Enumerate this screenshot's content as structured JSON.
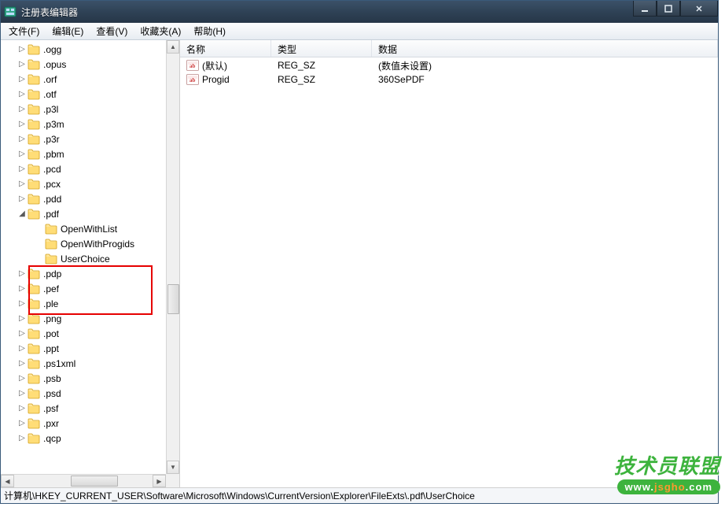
{
  "window": {
    "title": "注册表编辑器"
  },
  "menu": {
    "file": "文件(F)",
    "edit": "编辑(E)",
    "view": "查看(V)",
    "favorites": "收藏夹(A)",
    "help": "帮助(H)"
  },
  "tree": {
    "items": [
      {
        "label": ".ogg",
        "expanded": false
      },
      {
        "label": ".opus",
        "expanded": false
      },
      {
        "label": ".orf",
        "expanded": false
      },
      {
        "label": ".otf",
        "expanded": false
      },
      {
        "label": ".p3l",
        "expanded": false
      },
      {
        "label": ".p3m",
        "expanded": false
      },
      {
        "label": ".p3r",
        "expanded": false
      },
      {
        "label": ".pbm",
        "expanded": false
      },
      {
        "label": ".pcd",
        "expanded": false
      },
      {
        "label": ".pcx",
        "expanded": false
      },
      {
        "label": ".pdd",
        "expanded": false
      },
      {
        "label": ".pdf",
        "expanded": true
      },
      {
        "label": ".pdp",
        "expanded": false
      },
      {
        "label": ".pef",
        "expanded": false
      },
      {
        "label": ".ple",
        "expanded": false
      },
      {
        "label": ".png",
        "expanded": false
      },
      {
        "label": ".pot",
        "expanded": false
      },
      {
        "label": ".ppt",
        "expanded": false
      },
      {
        "label": ".ps1xml",
        "expanded": false
      },
      {
        "label": ".psb",
        "expanded": false
      },
      {
        "label": ".psd",
        "expanded": false
      },
      {
        "label": ".psf",
        "expanded": false
      },
      {
        "label": ".pxr",
        "expanded": false
      },
      {
        "label": ".qcp",
        "expanded": false
      }
    ],
    "pdf_children": [
      {
        "label": "OpenWithList"
      },
      {
        "label": "OpenWithProgids"
      },
      {
        "label": "UserChoice"
      }
    ]
  },
  "list": {
    "headers": {
      "name": "名称",
      "type": "类型",
      "data": "数据"
    },
    "rows": [
      {
        "name": "(默认)",
        "type": "REG_SZ",
        "data": "(数值未设置)"
      },
      {
        "name": "Progid",
        "type": "REG_SZ",
        "data": "360SePDF"
      }
    ]
  },
  "statusbar": {
    "path": "计算机\\HKEY_CURRENT_USER\\Software\\Microsoft\\Windows\\CurrentVersion\\Explorer\\FileExts\\.pdf\\UserChoice"
  },
  "watermark": {
    "line1": "技术员联盟",
    "line2_a": "www.",
    "line2_b": "jsgho",
    "line2_c": ".com"
  }
}
